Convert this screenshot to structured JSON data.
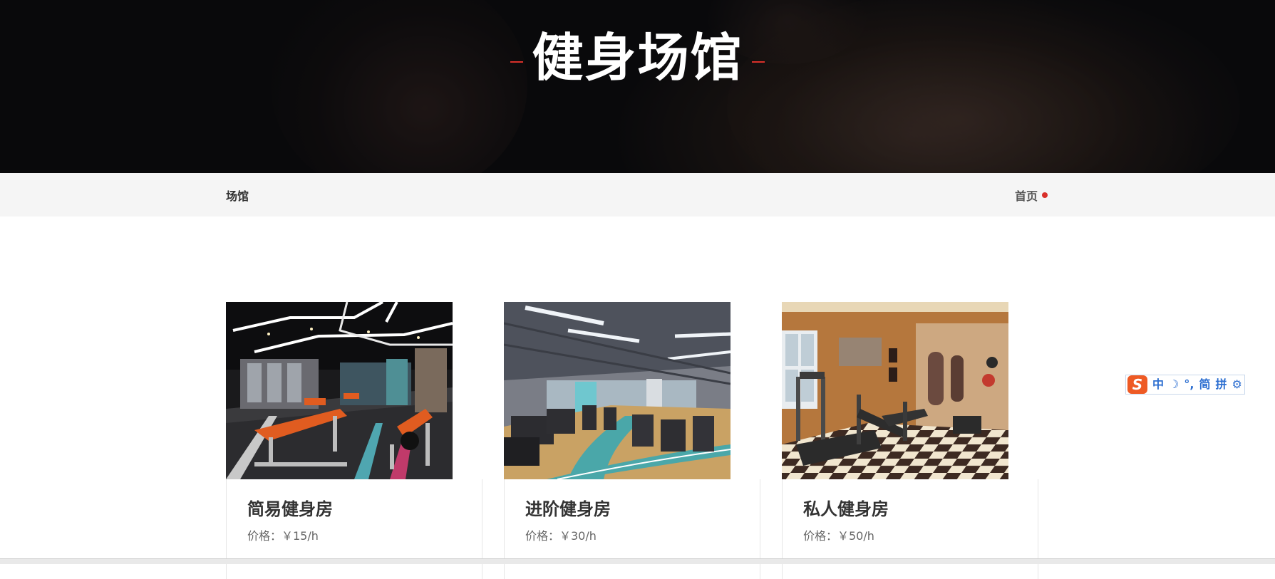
{
  "hero": {
    "title": "健身场馆"
  },
  "breadcrumb": {
    "current": "场馆",
    "home_link": "首页"
  },
  "cards": [
    {
      "title": "简易健身房",
      "price": "价格：￥15/h",
      "image": "gym-dark-neon-photo"
    },
    {
      "title": "进阶健身房",
      "price": "价格：￥30/h",
      "image": "gym-track-hall-photo"
    },
    {
      "title": "私人健身房",
      "price": "价格：￥50/h",
      "image": "home-gym-checker-photo"
    }
  ],
  "ime_toolbar": {
    "logo": "S",
    "items": [
      "中",
      "☽",
      "°,",
      "简",
      "拼",
      "⚙"
    ]
  },
  "colors": {
    "accent": "#d9302a",
    "hero_bg": "#0f0f12",
    "bar_bg": "#f5f5f5",
    "ime_blue": "#2d6fd1"
  }
}
